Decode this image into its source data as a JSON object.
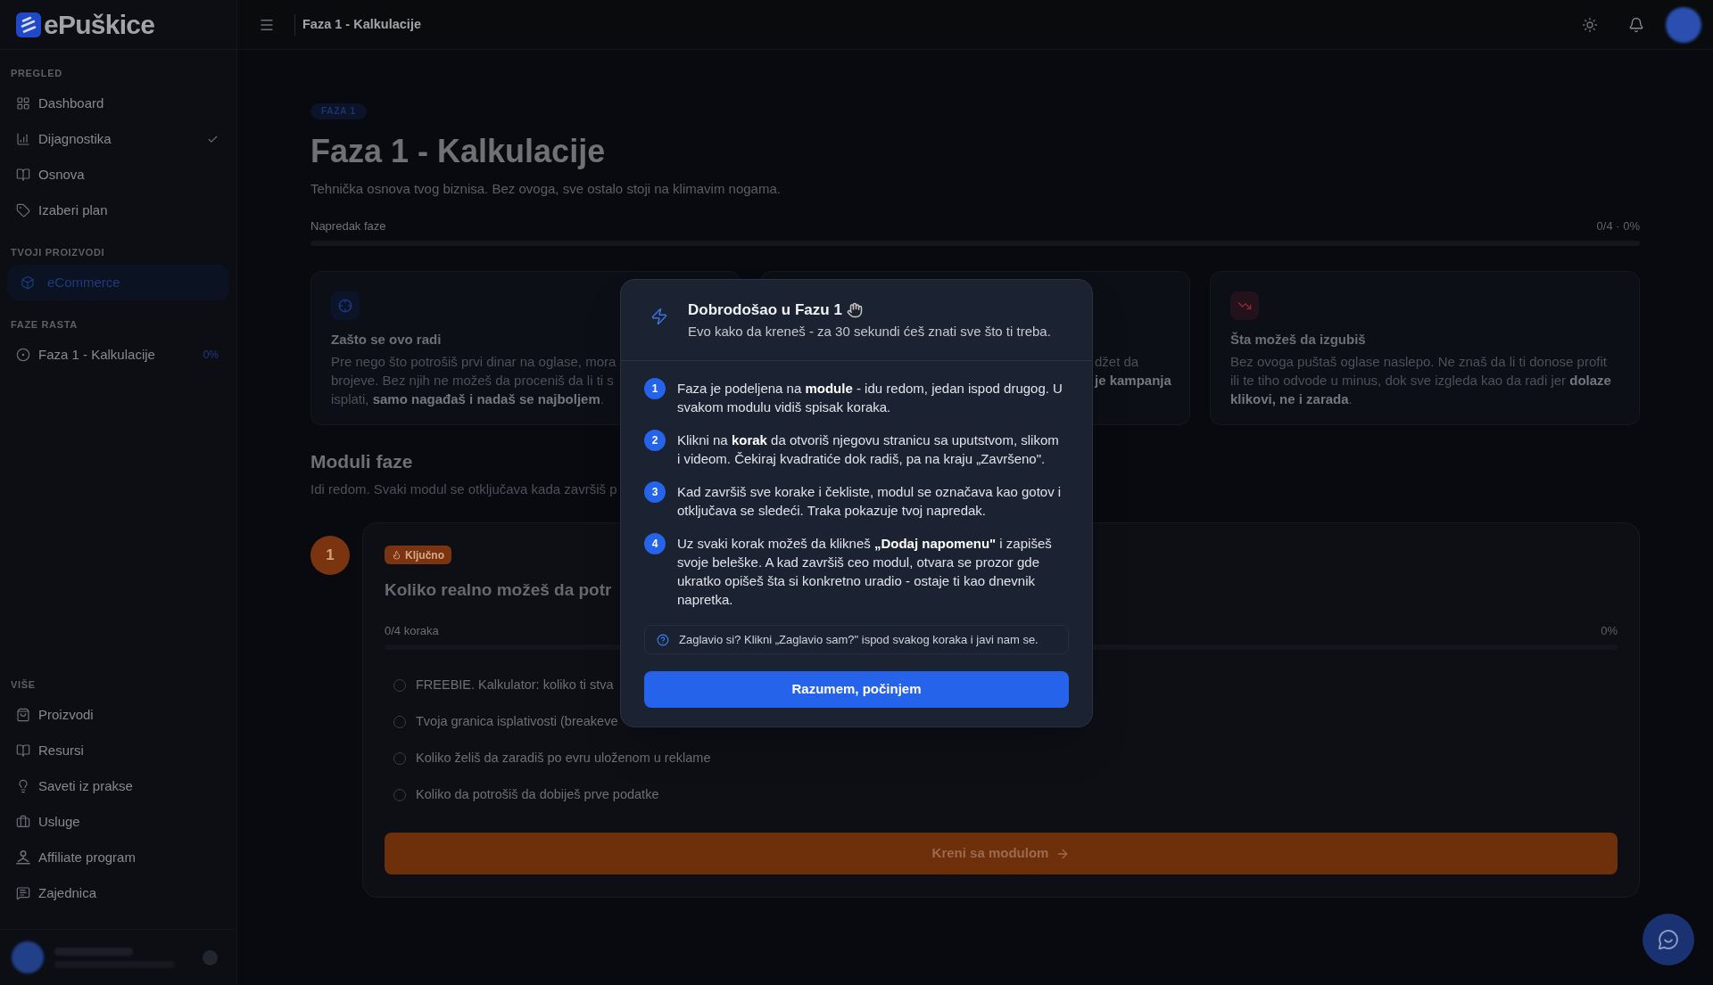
{
  "sidebar": {
    "logo": "ePuškice",
    "sections": [
      {
        "label": "PREGLED",
        "items": [
          {
            "label": "Dashboard",
            "selected": false,
            "checked": false
          },
          {
            "label": "Dijagnostika",
            "selected": false,
            "checked": true
          },
          {
            "label": "Osnova",
            "selected": false,
            "checked": false
          },
          {
            "label": "Izaberi plan",
            "selected": false,
            "checked": false
          }
        ]
      },
      {
        "label": "TVOJI PROIZVODI",
        "items": [
          {
            "label": "eCommerce",
            "selected": true,
            "checked": false
          }
        ]
      },
      {
        "label": "FAZE RASTA",
        "items": [
          {
            "label": "Faza 1 - Kalkulacije",
            "selected": false,
            "checked": false,
            "progress": "0%"
          }
        ]
      },
      {
        "label": "VIŠE",
        "items": [
          {
            "label": "Proizvodi",
            "selected": false,
            "checked": false
          },
          {
            "label": "Resursi",
            "selected": false,
            "checked": false
          },
          {
            "label": "Saveti iz prakse",
            "selected": false,
            "checked": false
          },
          {
            "label": "Usluge",
            "selected": false,
            "checked": false
          },
          {
            "label": "Affiliate program",
            "selected": false,
            "checked": false
          },
          {
            "label": "Zajednica",
            "selected": false,
            "checked": false
          }
        ]
      }
    ]
  },
  "header": {
    "title": "Faza 1 - Kalkulacije"
  },
  "page": {
    "tag": "FAZA 1",
    "title": "Faza 1 - Kalkulacije",
    "subtitle": "Tehnička osnova tvog biznisa. Bez ovoga, sve ostalo stoji na klimavim nogama.",
    "progress": {
      "label": "Napredak faze",
      "reading": "0/4 · 0%",
      "level": 0
    }
  },
  "cards": [
    {
      "kind": "target",
      "title": "Zašto se ovo radi",
      "lines": [
        "Pre nego što potrošiš prvi dinar na oglase, mora",
        "brojeve. Bez njih ne možeš da proceniš da li ti s",
        "isplati, **samo nagađaš i nadaš se najboljem**."
      ]
    },
    {
      "lines": [
        "džet da",
        "**je kampanja**"
      ]
    },
    {
      "kind": "loss",
      "title": "Šta možeš da izgubiš",
      "lines": [
        "Bez ovoga puštaš oglase naslepo. Ne znaš da li ti donose profit",
        "ili te tiho odvode u minus, dok sve izgleda kao da radi jer **dolaze**",
        "**klikovi, ne i zarada**."
      ]
    }
  ],
  "modules_section": {
    "title": "Moduli faze",
    "subtitle": "Idi redom. Svaki modul se otključava kada završiš p"
  },
  "modules": [
    {
      "number": "1",
      "tag": "Ključno",
      "title": "Koliko realno možeš da potr",
      "progress": {
        "label": "0/4 koraka",
        "reading": "0%",
        "level": 0
      },
      "steps": [
        {
          "label": "FREEBIE. Kalkulator: koliko ti stva",
          "done": false
        },
        {
          "label": "Tvoja granica isplativosti (breakeve",
          "done": false
        },
        {
          "label": "Koliko želiš da zaradiš po evru uloženom u reklame",
          "done": false
        },
        {
          "label": "Koliko da potrošiš da dobiješ prve podatke",
          "done": false
        }
      ],
      "button": "Kreni sa modulom"
    }
  ],
  "dialog": {
    "title": "Dobrodošao u Fazu 1",
    "subtitle": "Evo kako da kreneš - za 30 sekundi ćeš znati sve što ti treba.",
    "steps": [
      {
        "number": "1",
        "text": "Faza je podeljena na **module** - idu redom, jedan ispod drugog. U svakom modulu vidiš spisak koraka."
      },
      {
        "number": "2",
        "text": "Klikni na **korak** da otvoriš njegovu stranicu sa uputstvom, slikom i videom. Čekiraj kvadratiće dok radiš, pa na kraju „Završeno\"."
      },
      {
        "number": "3",
        "text": "Kad završiš sve korake i čekliste, modul se označava kao gotov i otključava se sledeći. Traka pokazuje tvoj napredak."
      },
      {
        "number": "4",
        "text": "Uz svaki korak možeš da klikneš **„Dodaj napomenu\"** i zapišeš svoje beleške. A kad završiš ceo modul, otvara se prozor gde ukratko opišeš šta si konkretno uradio - ostaje ti kao dnevnik napretka."
      }
    ],
    "help": "Zaglavio si? Klikni „Zaglavio sam?\" ispod svakog koraka i javi nam se.",
    "button": "Razumem, počinjem"
  }
}
